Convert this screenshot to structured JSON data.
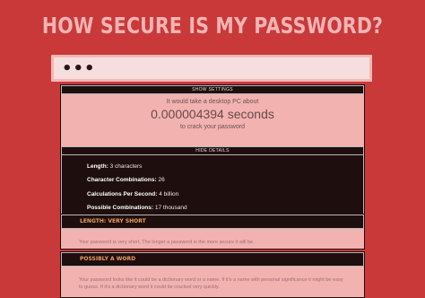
{
  "page": {
    "title": "HOW SECURE IS MY PASSWORD?"
  },
  "password": {
    "masked_value": "•••"
  },
  "crack_panel": {
    "show_settings_label": "SHOW SETTINGS",
    "line_before": "It would take a desktop PC about",
    "time_value": "0.000004394 seconds",
    "line_after": "to crack your password",
    "hide_details_label": "HIDE DETAILS"
  },
  "details": {
    "length_label": "Length:",
    "length_value": "3 characters",
    "combos_label": "Character Combinations:",
    "combos_value": "26",
    "calc_label": "Calculations Per Second:",
    "calc_value": "4 billion",
    "possible_label": "Possible Combinations:",
    "possible_value": "17 thousand"
  },
  "checks": [
    {
      "heading": "LENGTH: VERY SHORT",
      "body": "Your password is very short. The longer a password is the more secure it will be."
    },
    {
      "heading": "POSSIBLY A WORD",
      "body": "Your password looks like it could be a dictionary word or a name. If it's a name with personal significance it might be easy to guess. If it's a dictionary word it could be cracked very quickly."
    }
  ],
  "colors": {
    "background": "#c9393a",
    "title": "#f3b4b3",
    "panel": "#f1b2b0",
    "dark_bar": "#1f0e0e",
    "check_heading": "#e8a060"
  }
}
